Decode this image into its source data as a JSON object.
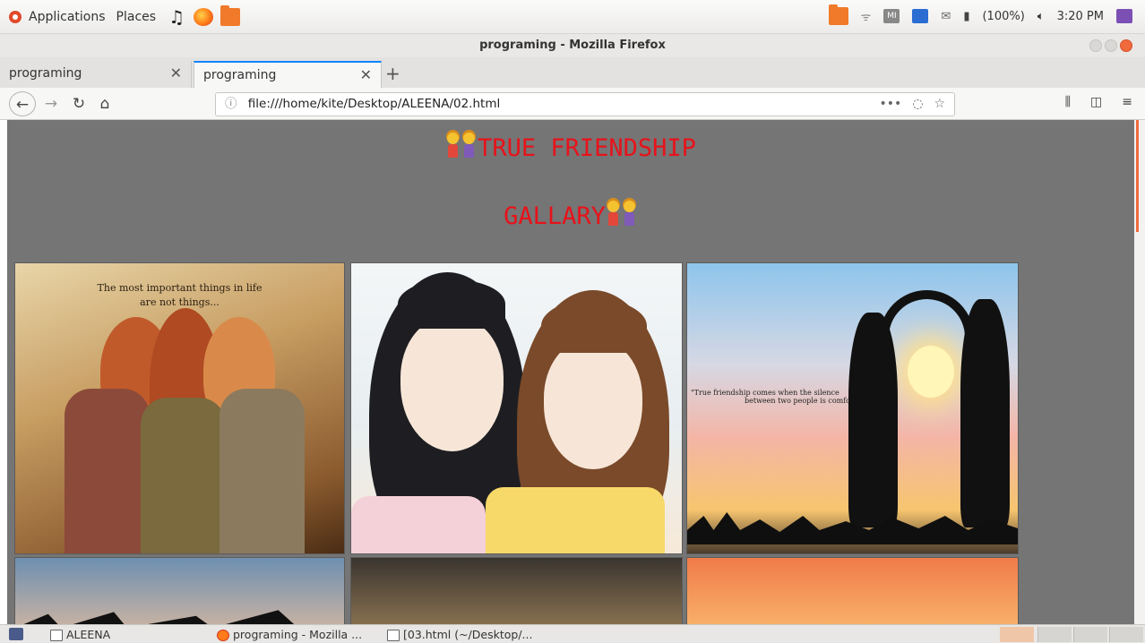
{
  "panel": {
    "applications_label": "Applications",
    "places_label": "Places",
    "battery_label": "(100%)",
    "clock": "3:20 PM",
    "tray_mail_label": "MI"
  },
  "window": {
    "title": "programing - Mozilla Firefox"
  },
  "tabs": [
    {
      "label": "programing",
      "active": false
    },
    {
      "label": "programing",
      "active": true
    }
  ],
  "nav": {
    "url": "file:///home/kite/Desktop/ALEENA/02.html",
    "more_label": "•••"
  },
  "page": {
    "heading_1": "TRUE FRIENDSHIP",
    "heading_2": "GALLARY",
    "heading_color": "#e8121a",
    "background_color": "#757575",
    "pic_1_caption_line1": "The most important things in life",
    "pic_1_caption_line2": "are not things...",
    "pic_3_caption_line1": "\"True friendship comes when the silence",
    "pic_3_caption_line2": "between two people is comfortable.\""
  },
  "taskbar": {
    "task_1": "ALEENA",
    "task_2": "programing - Mozilla ...",
    "task_3": "[03.html (~/Desktop/..."
  }
}
